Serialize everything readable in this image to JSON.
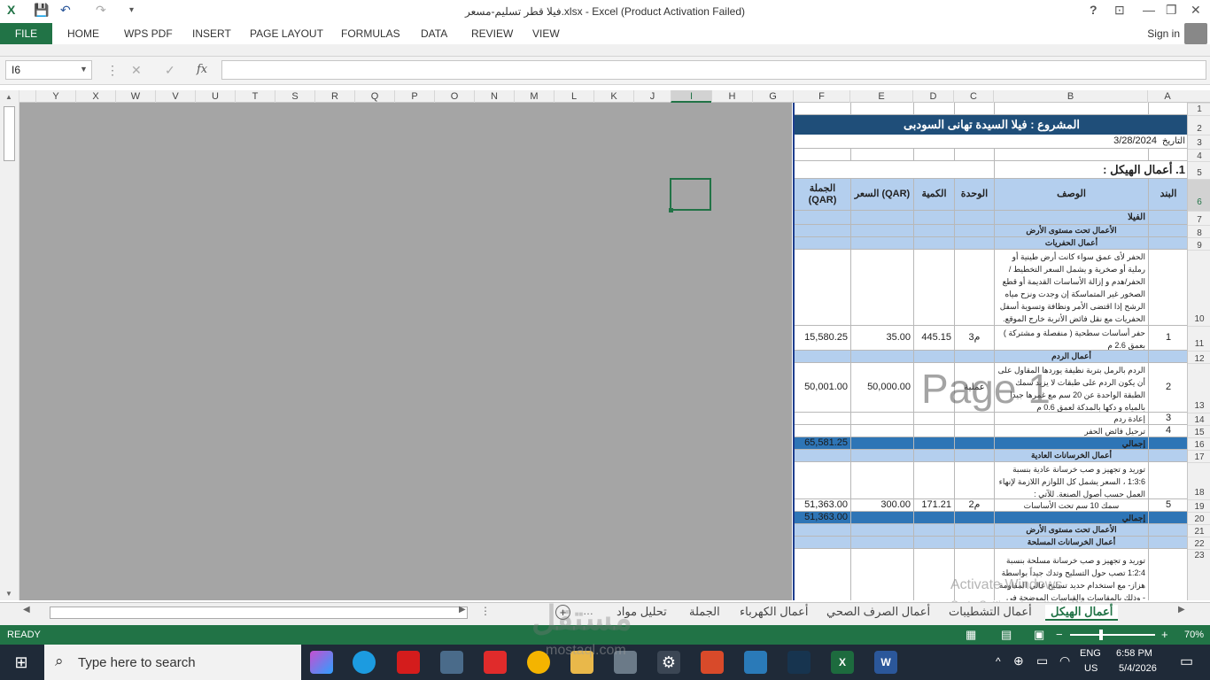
{
  "title_bar": {
    "title": "فيلا قطر تسليم-مسعر.xlsx - Excel (Product Activation Failed)",
    "help": "?",
    "restore": "❐",
    "minimize": "—",
    "close": "✕"
  },
  "ribbon": {
    "file": "FILE",
    "tabs": [
      "HOME",
      "WPS PDF",
      "INSERT",
      "PAGE LAYOUT",
      "FORMULAS",
      "DATA",
      "REVIEW",
      "VIEW"
    ],
    "sign_in": "Sign in"
  },
  "formula_bar": {
    "name_box": "I6",
    "fx": "fx",
    "value": ""
  },
  "columns": [
    "Y",
    "X",
    "W",
    "V",
    "U",
    "T",
    "S",
    "R",
    "Q",
    "P",
    "O",
    "N",
    "M",
    "L",
    "K",
    "J",
    "I",
    "H",
    "G",
    "F",
    "E",
    "D",
    "C",
    "B",
    "A"
  ],
  "selected_column": "I",
  "rows": [
    "1",
    "2",
    "3",
    "4",
    "5",
    "6",
    "7",
    "8",
    "9",
    "10",
    "11",
    "12",
    "13",
    "14",
    "15",
    "16",
    "17",
    "18",
    "19",
    "20",
    "21",
    "22",
    "23"
  ],
  "selected_row": "6",
  "sheet": {
    "project_title": "المشروع : فيلا السيدة تهانى السودبى",
    "date_label": "التاريخ",
    "date_value": "3/28/2024",
    "section_title": "1. أعمال الهيكل :",
    "headers": {
      "item": "البند",
      "description": "الوصف",
      "unit": "الوحدة",
      "qty": "الكمية",
      "price": "السعر (QAR)",
      "total": "الجملة (QAR)"
    },
    "villa": "الفيلا",
    "below_ground": "الأعمال تحت مستوى الأرض",
    "excavation": "أعمال الحفريات",
    "excavation_desc": "الحفر لأى عمق سواء كانت أرض طينية أو رملية أو صخرية و يشمل السعر التخطيط /الحفر/هدم و إزالة الأساسات القديمة أو قطع الصخور غير المتماسكة إن وجدت ونزح مياه الرشح إذا اقتضى الأمر ونظافة وتسوية أسفل الحفريات مع نقل فائض الأتربة خارج الموقع.",
    "item1": {
      "no": "1",
      "desc": "حفر أساسات سطحية ( منفصلة و مشتركة ) بعمق 2.6 م",
      "unit": "م3",
      "qty": "445.15",
      "price": "35.00",
      "total": "15,580.25"
    },
    "backfill": "أعمال الردم",
    "item2": {
      "no": "2",
      "desc": "الردم بالرمل بتربة نظيفة يوردها المقاول على أن يكون الردم على طبقات لا يزيد سمك الطبقة الواحدة عن 20 سم مع غمرها جيدا بالمياه و دكها بالمدكة لعمق 0.6 م",
      "unit": "عملية",
      "price": "50,000.00",
      "total": "50,001.00"
    },
    "item3": {
      "no": "3",
      "desc": "إعادة ردم"
    },
    "item4": {
      "no": "4",
      "desc": "ترحيل فائض الحفر"
    },
    "subtotal1": {
      "label": "إجمالي",
      "total": "65,581.25"
    },
    "plain_concrete": "أعمال الخرسانات العادية",
    "plain_desc": "توريد و تجهيز و صب خرسانة عادية بنسبة 1:3:6 ، السعر يشمل كل اللوازم اللازمة لإنهاء العمل حسب أصول الصنعة. للآتي :",
    "item5": {
      "no": "5",
      "desc": "سمك 10 سم تحت الأساسات",
      "unit": "م2",
      "qty": "171.21",
      "price": "300.00",
      "total": "51,363.00"
    },
    "subtotal2": {
      "label": "إجمالي",
      "total": "51,363.00"
    },
    "below_ground2": "الأعمال تحت مستوى الأرض",
    "reinforced": "أعمال الخرسانات المسلحة",
    "reinforced_desc": "توريد و تجهيز و صب خرسانة مسلحة بنسبة 1:2:4 تصب حول التسليح وتدك جيداً بواسطة هزاز- مع استخدام حديد تسليح عالي المقاومة - وذلك بالمقاسات والقياسات الموضحة في المخططات المرفقة السعر"
  },
  "page_watermark": "Page 1",
  "activate": {
    "line1": "Activate Windows",
    "line2": "Go to Settings to activate Windows."
  },
  "sheet_tabs": [
    "أعمال الهيكل",
    "أعمال التشطيبات",
    "أعمال الصرف الصحي",
    "أعمال الكهرباء",
    "الجملة",
    "تحليل مواد"
  ],
  "status": {
    "ready": "READY",
    "zoom": "70%"
  },
  "taskbar": {
    "search_placeholder": "Type here to search",
    "lang1": "ENG",
    "lang2": "US",
    "time": "6:58 PM",
    "date": "5/4/2026"
  },
  "brand_watermark": {
    "arabic": "مستقل",
    "latin": "mostaql.com"
  },
  "colors": {
    "excel_green": "#217346",
    "header_blue": "#1f4e79",
    "light_blue": "#b4cfee",
    "mid_blue": "#2e75b6"
  }
}
